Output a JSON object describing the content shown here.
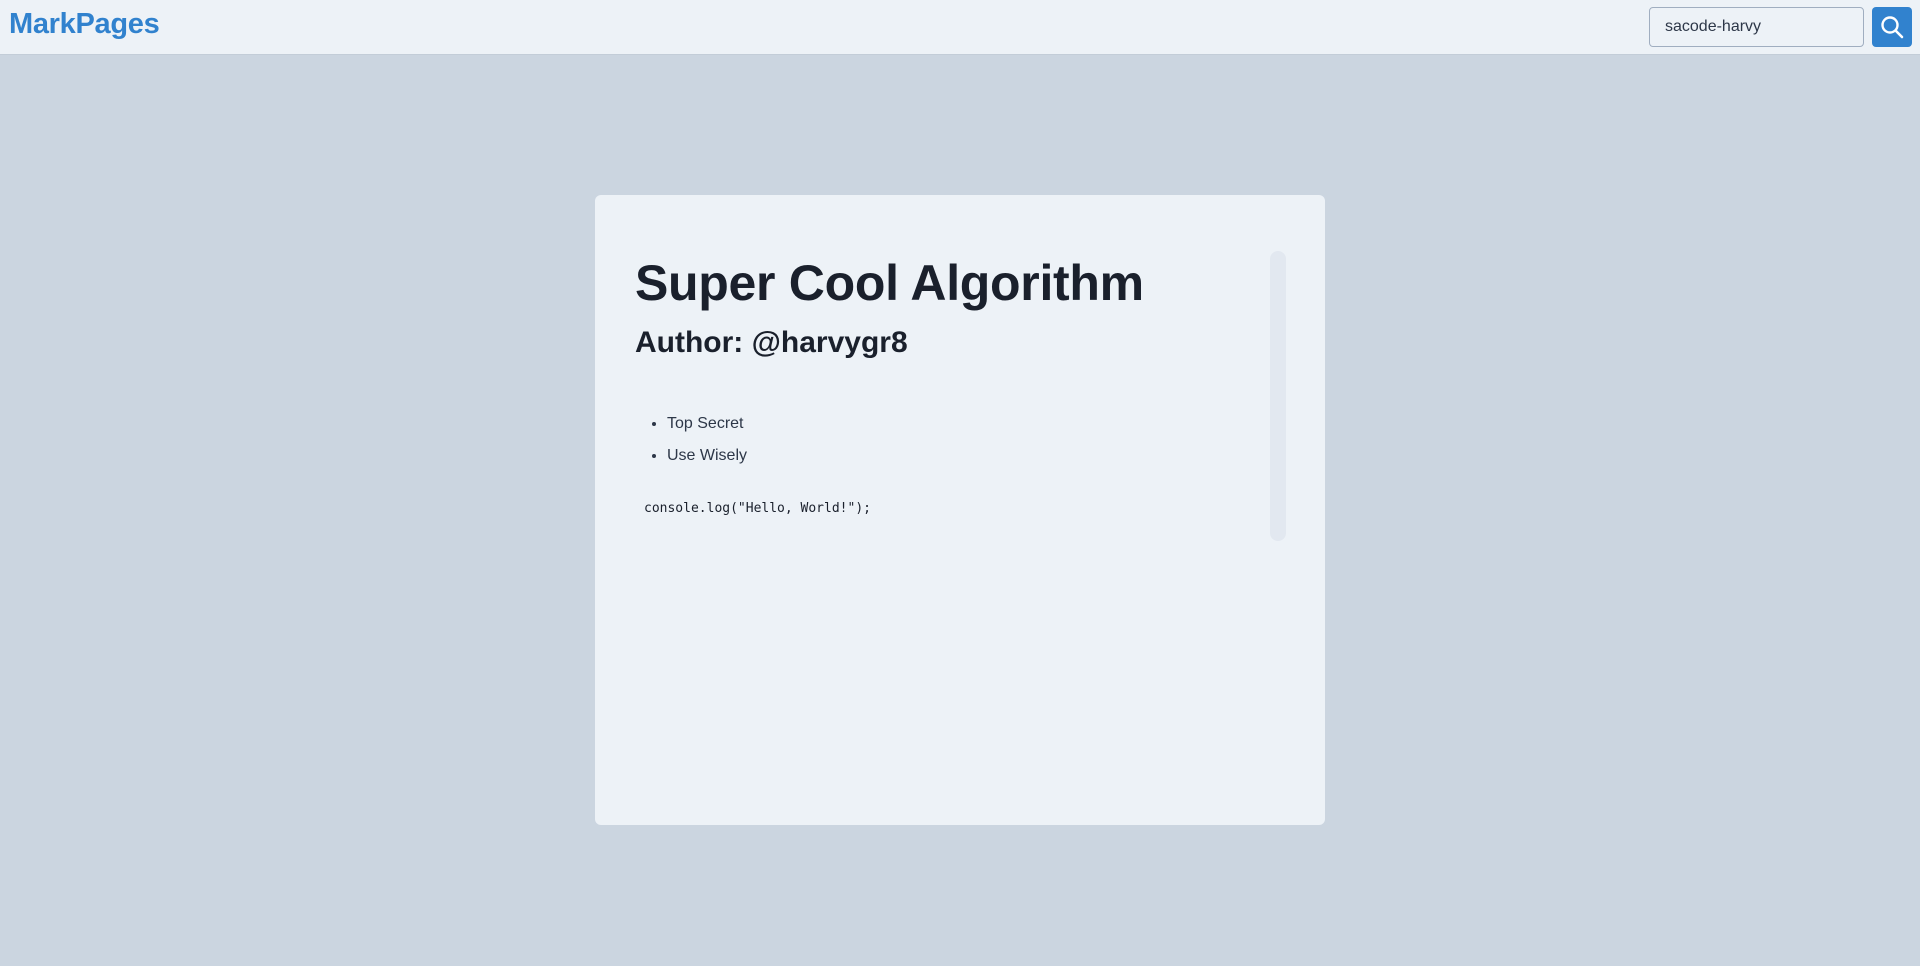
{
  "header": {
    "brand": "MarkPages",
    "search": {
      "value": "sacode-harvy",
      "button_icon": "search-icon"
    }
  },
  "document": {
    "title": "Super Cool Algorithm",
    "subtitle": "Author: @harvygr8",
    "list": [
      "Top Secret",
      "Use Wisely"
    ],
    "code": "console.log(\"Hello, World!\");"
  },
  "colors": {
    "accent": "#3182ce",
    "page_background": "#cbd5e0",
    "surface": "#edf2f7",
    "text": "#1a202c"
  }
}
